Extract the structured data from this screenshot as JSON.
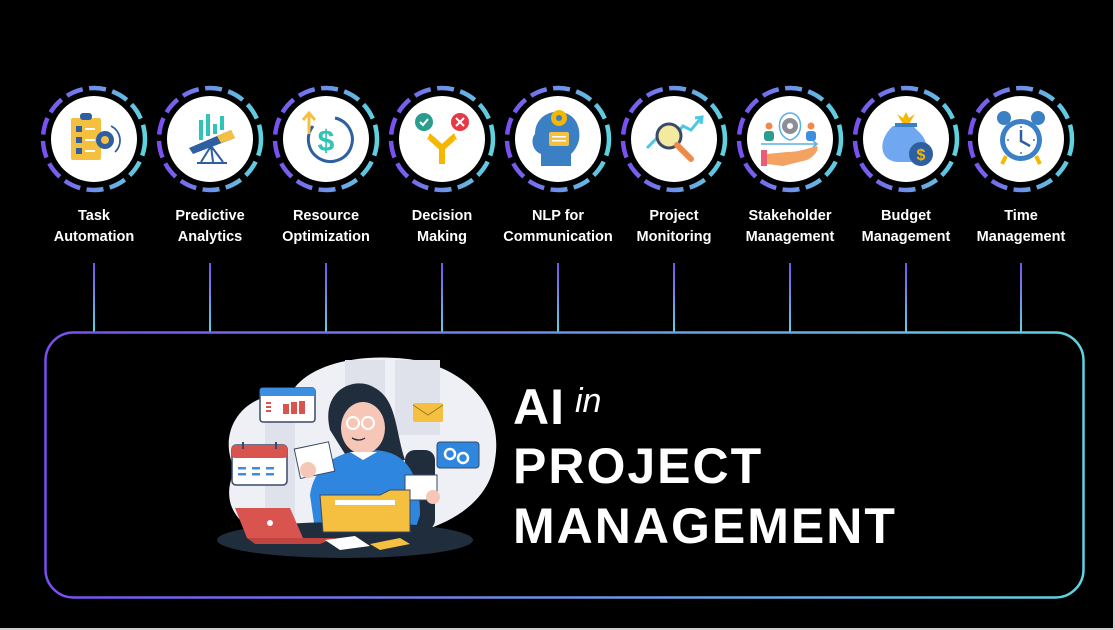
{
  "features": [
    {
      "label_line1": "Task",
      "label_line2": "Automation",
      "icon": "task-automation-icon"
    },
    {
      "label_line1": "Predictive",
      "label_line2": "Analytics",
      "icon": "predictive-analytics-icon"
    },
    {
      "label_line1": "Resource",
      "label_line2": "Optimization",
      "icon": "resource-optimization-icon"
    },
    {
      "label_line1": "Decision",
      "label_line2": "Making",
      "icon": "decision-making-icon"
    },
    {
      "label_line1": "NLP for",
      "label_line2": "Communication",
      "icon": "nlp-communication-icon"
    },
    {
      "label_line1": "Project",
      "label_line2": "Monitoring",
      "icon": "project-monitoring-icon"
    },
    {
      "label_line1": "Stakeholder",
      "label_line2": "Management",
      "icon": "stakeholder-management-icon"
    },
    {
      "label_line1": "Budget",
      "label_line2": "Management",
      "icon": "budget-management-icon"
    },
    {
      "label_line1": "Time",
      "label_line2": "Management",
      "icon": "time-management-icon"
    }
  ],
  "title": {
    "ai": "AI",
    "in": "in",
    "line2": "PROJECT",
    "line3": "MANAGEMENT"
  },
  "colors": {
    "background": "#000000",
    "gradient_start": "#7a4ff0",
    "gradient_end": "#5fd3e0",
    "icon_bg": "#ffffff"
  }
}
